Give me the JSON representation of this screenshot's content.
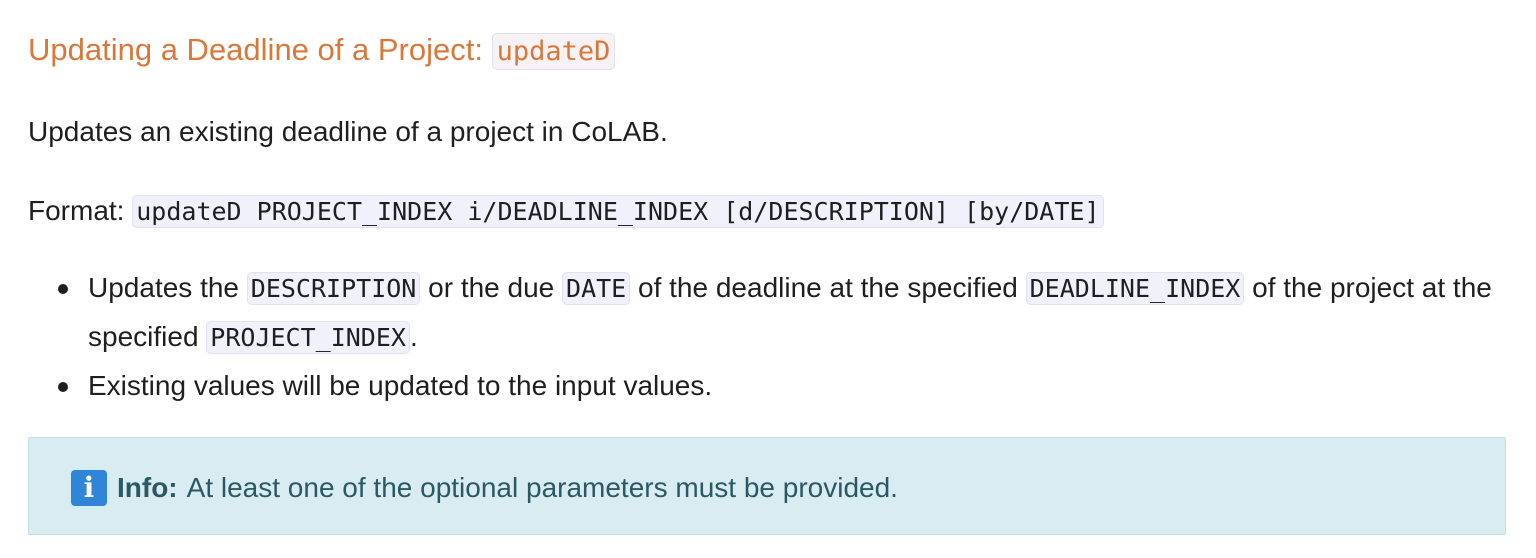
{
  "section": {
    "title_text": "Updating a Deadline of a Project: ",
    "title_code": "updateD"
  },
  "description": "Updates an existing deadline of a project in CoLAB.",
  "format": {
    "label": "Format: ",
    "command": "updateD PROJECT_INDEX i/DEADLINE_INDEX [d/DESCRIPTION] [by/DATE]"
  },
  "bullets": {
    "item1": {
      "t1": "Updates the ",
      "c1": "DESCRIPTION",
      "t2": " or the due ",
      "c2": "DATE",
      "t3": " of the deadline at the specified ",
      "c3": "DEADLINE_INDEX",
      "t4": " of the project at the specified ",
      "c4": "PROJECT_INDEX",
      "t5": "."
    },
    "item2": "Existing values will be updated to the input values."
  },
  "info": {
    "icon": "info-icon",
    "icon_glyph": "i",
    "label": "Info:",
    "text": "At least one of the optional parameters must be provided."
  },
  "colors": {
    "heading": "#d9783a",
    "info_background": "#d8ecf1",
    "info_text": "#2b5864",
    "info_icon": "#2f86d6"
  }
}
